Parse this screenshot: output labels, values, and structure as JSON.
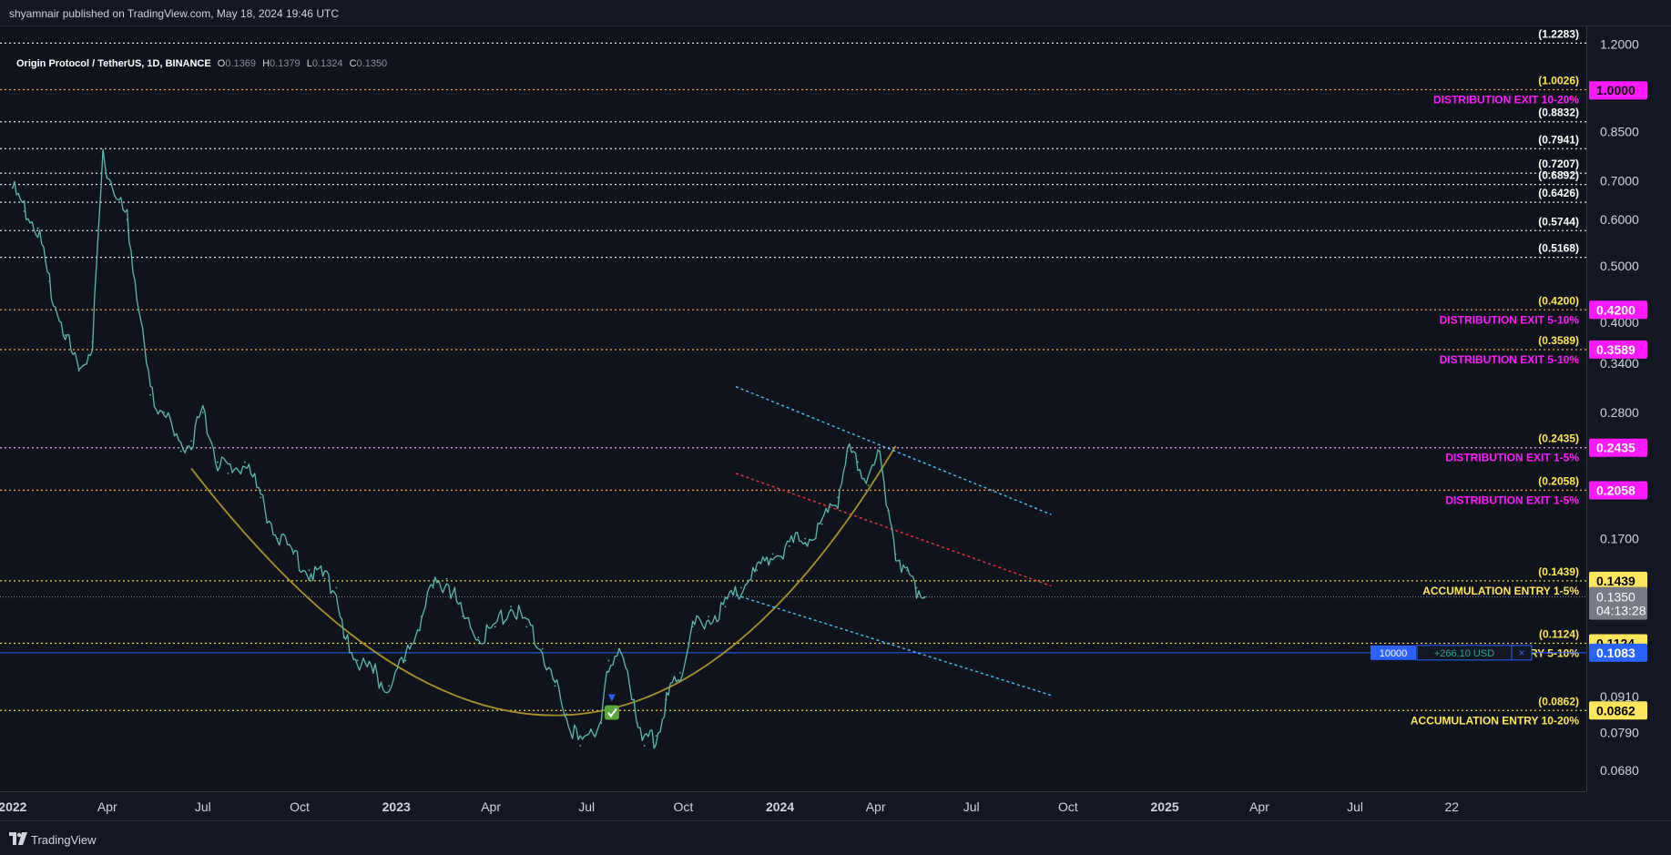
{
  "header": {
    "published": "shyamnair published on TradingView.com, May 18, 2024 19:46 UTC"
  },
  "legend": {
    "symbol": "Origin Protocol / TetherUS, 1D, BINANCE",
    "o_label": "O",
    "o_value": "0.1369",
    "h_label": "H",
    "h_value": "0.1379",
    "l_label": "L",
    "l_value": "0.1324",
    "c_label": "C",
    "c_value": "0.1350"
  },
  "footer": {
    "brand": "TradingView",
    "logo": "tradingview-logo-icon"
  },
  "colors": {
    "background": "#0f131c",
    "candle": "#5fb8ad",
    "white_level": "#e0e3eb",
    "yellow_level": "#f0d64a",
    "orange_level": "#f39a4a",
    "magenta": "#ff1aff",
    "accum_yellow": "#ffe65c",
    "channel_cyan": "#4fc3f7",
    "channel_red": "#f23645",
    "arc": "#a8902a",
    "position_blue": "#2962ff"
  },
  "chart_data": {
    "type": "line",
    "ticker": "OGNUSDT",
    "scale": "log",
    "ylim": [
      0.064,
      1.26
    ],
    "x_range": [
      "2021-12-20",
      "2026-02-06"
    ],
    "x_ticks": [
      {
        "date": "2022-01-01",
        "label": "2022",
        "bold": true
      },
      {
        "date": "2022-04-01",
        "label": "Apr"
      },
      {
        "date": "2022-07-01",
        "label": "Jul"
      },
      {
        "date": "2022-10-01",
        "label": "Oct"
      },
      {
        "date": "2023-01-01",
        "label": "2023",
        "bold": true
      },
      {
        "date": "2023-04-01",
        "label": "Apr"
      },
      {
        "date": "2023-07-01",
        "label": "Jul"
      },
      {
        "date": "2023-10-01",
        "label": "Oct"
      },
      {
        "date": "2024-01-01",
        "label": "2024",
        "bold": true
      },
      {
        "date": "2024-04-01",
        "label": "Apr"
      },
      {
        "date": "2024-07-01",
        "label": "Jul"
      },
      {
        "date": "2024-10-01",
        "label": "Oct"
      },
      {
        "date": "2025-01-01",
        "label": "2025",
        "bold": true
      },
      {
        "date": "2025-04-01",
        "label": "Apr"
      },
      {
        "date": "2025-07-01",
        "label": "Jul"
      },
      {
        "date": "2025-10-01",
        "label": "22"
      }
    ],
    "y_ticks": [
      "1.2000",
      "0.8500",
      "0.7000",
      "0.6000",
      "0.5000",
      "0.4000",
      "0.3400",
      "0.2800",
      "0.1700",
      "0.0910",
      "0.0790",
      "0.0680"
    ],
    "price_series": {
      "name": "",
      "dates": [
        "2022-01-01",
        "2022-01-12",
        "2022-01-25",
        "2022-02-05",
        "2022-02-20",
        "2022-03-05",
        "2022-03-18",
        "2022-03-28",
        "2022-04-08",
        "2022-04-20",
        "2022-05-01",
        "2022-05-12",
        "2022-05-25",
        "2022-06-10",
        "2022-06-20",
        "2022-07-01",
        "2022-07-15",
        "2022-07-25",
        "2022-08-10",
        "2022-08-25",
        "2022-09-10",
        "2022-09-25",
        "2022-10-10",
        "2022-10-25",
        "2022-11-05",
        "2022-11-12",
        "2022-11-25",
        "2022-12-10",
        "2022-12-25",
        "2023-01-10",
        "2023-01-25",
        "2023-02-05",
        "2023-02-18",
        "2023-03-05",
        "2023-03-20",
        "2023-04-05",
        "2023-04-20",
        "2023-05-05",
        "2023-05-20",
        "2023-06-01",
        "2023-06-12",
        "2023-06-25",
        "2023-07-05",
        "2023-07-15",
        "2023-07-22",
        "2023-08-01",
        "2023-08-15",
        "2023-08-25",
        "2023-09-05",
        "2023-09-15",
        "2023-09-28",
        "2023-10-10",
        "2023-10-25",
        "2023-11-10",
        "2023-11-25",
        "2023-12-10",
        "2023-12-25",
        "2024-01-10",
        "2024-01-25",
        "2024-02-10",
        "2024-02-25",
        "2024-03-05",
        "2024-03-15",
        "2024-03-25",
        "2024-04-05",
        "2024-04-13",
        "2024-04-20",
        "2024-05-01",
        "2024-05-10",
        "2024-05-18"
      ],
      "values": [
        0.68,
        0.62,
        0.58,
        0.47,
        0.38,
        0.33,
        0.37,
        0.78,
        0.66,
        0.6,
        0.42,
        0.3,
        0.28,
        0.24,
        0.25,
        0.28,
        0.23,
        0.22,
        0.23,
        0.2,
        0.17,
        0.16,
        0.15,
        0.145,
        0.14,
        0.115,
        0.105,
        0.1,
        0.095,
        0.105,
        0.125,
        0.14,
        0.145,
        0.125,
        0.115,
        0.12,
        0.13,
        0.12,
        0.11,
        0.095,
        0.085,
        0.075,
        0.08,
        0.082,
        0.105,
        0.11,
        0.09,
        0.075,
        0.078,
        0.09,
        0.1,
        0.12,
        0.125,
        0.13,
        0.14,
        0.15,
        0.16,
        0.165,
        0.17,
        0.18,
        0.2,
        0.24,
        0.23,
        0.21,
        0.24,
        0.19,
        0.16,
        0.15,
        0.14,
        0.135
      ]
    },
    "levels": [
      {
        "price": 1.205,
        "color": "white",
        "label": "(1.2283)",
        "tag": ""
      },
      {
        "price": 1.0026,
        "color": "orange",
        "label": "(1.0026)",
        "tag": "DISTRIBUTION EXIT 10-20%"
      },
      {
        "price": 0.8832,
        "color": "white",
        "label": "(0.8832)",
        "tag": ""
      },
      {
        "price": 0.7941,
        "color": "white",
        "label": "(0.7941)",
        "tag": ""
      },
      {
        "price": 0.7207,
        "color": "white",
        "label": "(0.7207)",
        "tag": ""
      },
      {
        "price": 0.6892,
        "color": "white",
        "label": "(0.6892)",
        "tag": ""
      },
      {
        "price": 0.6426,
        "color": "white",
        "label": "(0.6426)",
        "tag": ""
      },
      {
        "price": 0.5744,
        "color": "white",
        "label": "(0.5744)",
        "tag": ""
      },
      {
        "price": 0.5168,
        "color": "white",
        "label": "(0.5168)",
        "tag": ""
      },
      {
        "price": 0.42,
        "color": "orange",
        "label": "(0.4200)",
        "tag": "DISTRIBUTION EXIT 5-10%"
      },
      {
        "price": 0.3589,
        "color": "orange",
        "label": "(0.3589)",
        "tag": "DISTRIBUTION EXIT 5-10%"
      },
      {
        "price": 0.2435,
        "color": "pink",
        "label": "(0.2435)",
        "tag": "DISTRIBUTION EXIT 1-5%"
      },
      {
        "price": 0.2058,
        "color": "orange",
        "label": "(0.2058)",
        "tag": "DISTRIBUTION EXIT 1-5%"
      },
      {
        "price": 0.1439,
        "color": "yellow",
        "label": "(0.1439)",
        "tag": "ACCUMULATION ENTRY 1-5%"
      },
      {
        "price": 0.1124,
        "color": "yellow",
        "label": "(0.1124)",
        "tag": "RY 5-10%"
      },
      {
        "price": 0.0862,
        "color": "yellow",
        "label": "(0.0862)",
        "tag": "ACCUMULATION ENTRY 10-20%"
      }
    ],
    "price_tags": [
      {
        "price": 1.0,
        "text": "1.0000",
        "bg": "#ff1aff",
        "fg": "#000000"
      },
      {
        "price": 0.42,
        "text": "0.4200",
        "bg": "#ff1aff",
        "fg": "#ffffff"
      },
      {
        "price": 0.3589,
        "text": "0.3589",
        "bg": "#ff1aff",
        "fg": "#ffffff"
      },
      {
        "price": 0.2435,
        "text": "0.2435",
        "bg": "#ff1aff",
        "fg": "#ffffff"
      },
      {
        "price": 0.2058,
        "text": "0.2058",
        "bg": "#ff1aff",
        "fg": "#ffffff"
      },
      {
        "price": 0.1439,
        "text": "0.1439",
        "bg": "#ffe65c",
        "fg": "#000000"
      },
      {
        "price": 0.1124,
        "text": "0.1124",
        "bg": "#ffe65c",
        "fg": "#000000"
      },
      {
        "price": 0.1083,
        "text": "0.1083",
        "bg": "#2962ff",
        "fg": "#ffffff"
      },
      {
        "price": 0.0862,
        "text": "0.0862",
        "bg": "#ffe65c",
        "fg": "#000000"
      }
    ],
    "last_price": {
      "price": 0.135,
      "text": "0.1350",
      "countdown": "04:13:28"
    },
    "position": {
      "price": 0.1083,
      "qty": "10000",
      "pnl": "+266.10 USD",
      "close": "×"
    },
    "channel_upper": [
      [
        "2023-11-20",
        0.31
      ],
      [
        "2024-09-15",
        0.187
      ]
    ],
    "channel_lower": [
      [
        "2023-11-20",
        0.136
      ],
      [
        "2024-09-15",
        0.0915
      ]
    ],
    "channel_mid": [
      [
        "2023-11-20",
        0.22
      ],
      [
        "2024-09-15",
        0.141
      ]
    ],
    "arc": {
      "start": [
        "2022-06-20",
        0.2244
      ],
      "control": [
        "2023-06-26",
        0.0305
      ],
      "end": [
        "2024-04-20",
        0.2452
      ]
    },
    "buy_marker": {
      "date": "2023-07-25",
      "price": 0.0855
    }
  }
}
